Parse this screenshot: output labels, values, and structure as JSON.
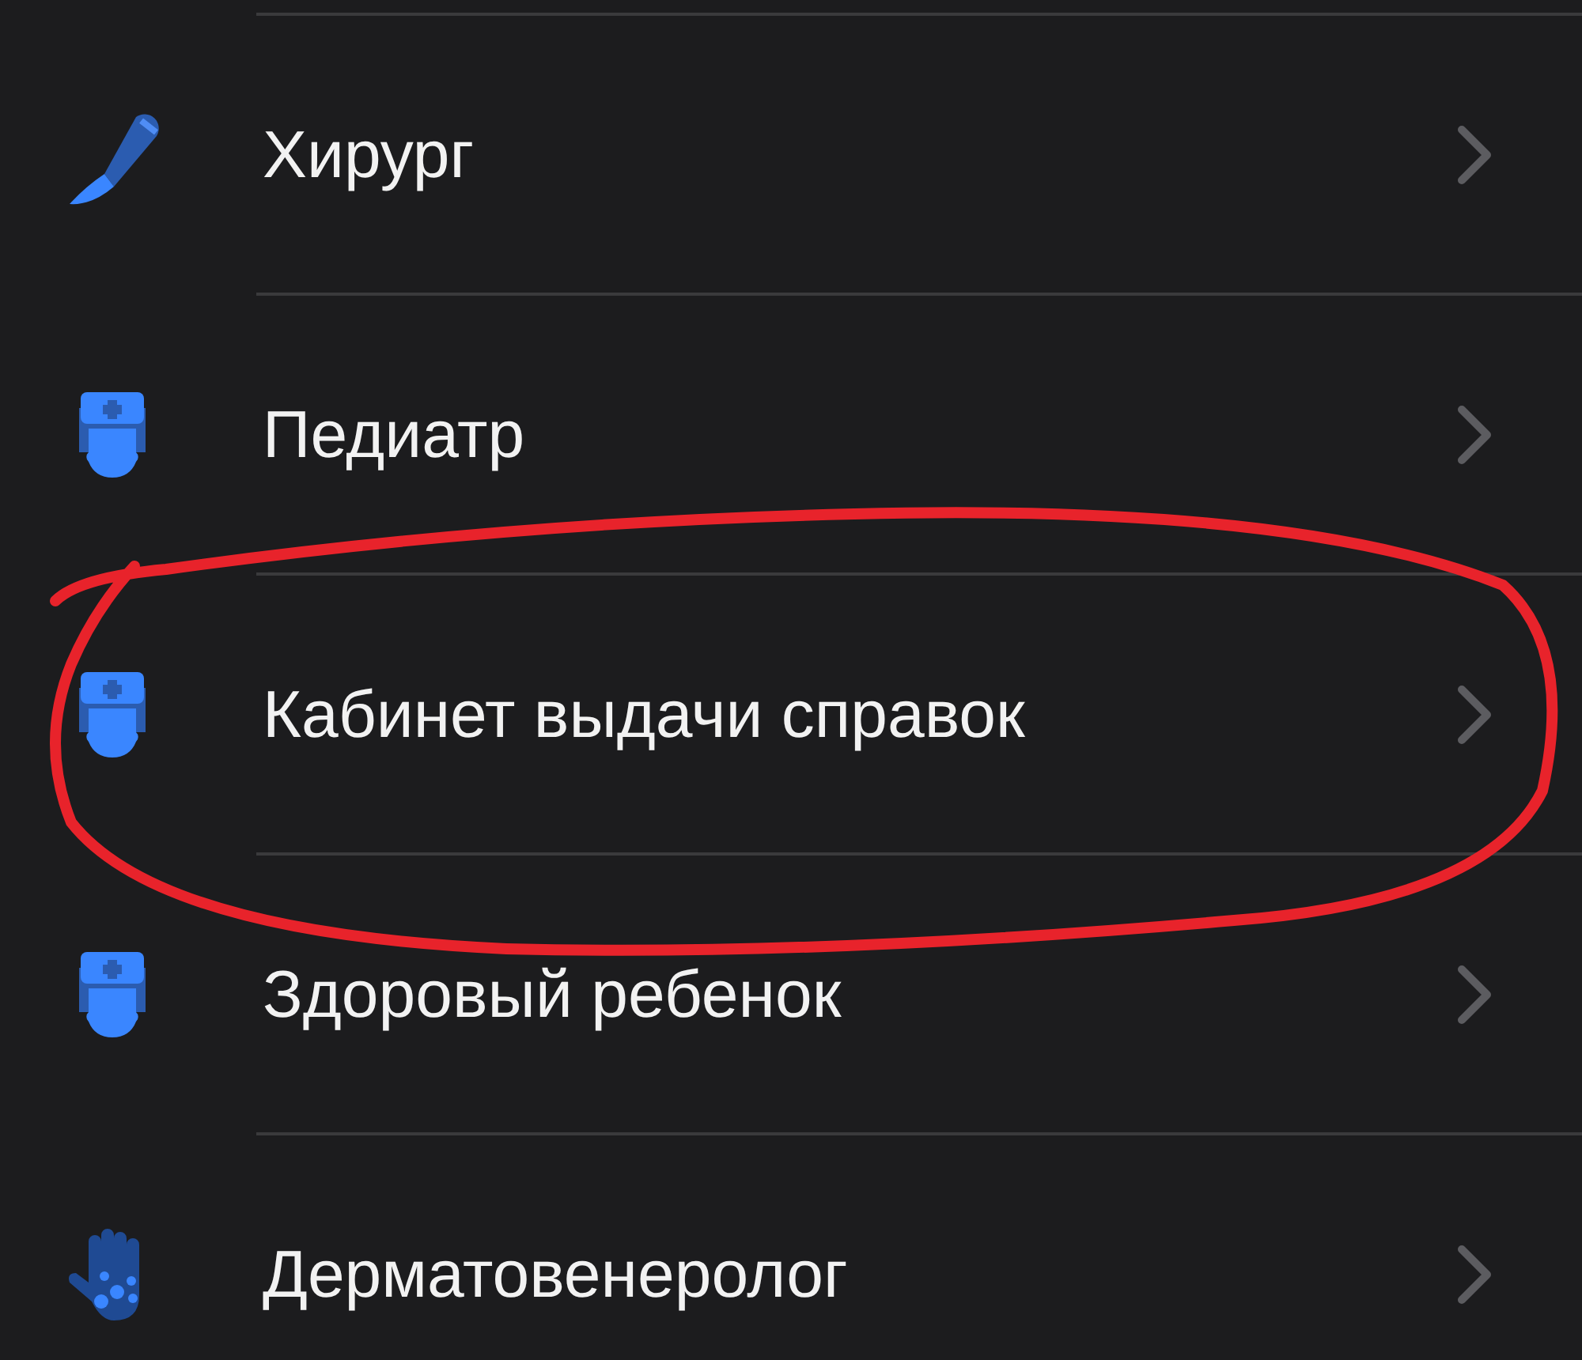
{
  "items": [
    {
      "label": "Хирург",
      "kind": "surgeon"
    },
    {
      "label": "Педиатр",
      "kind": "doctor"
    },
    {
      "label": "Кабинет выдачи справок",
      "kind": "doctor"
    },
    {
      "label": "Здоровый ребенок",
      "kind": "doctor"
    },
    {
      "label": "Дерматовенеролог",
      "kind": "dermatology"
    }
  ]
}
